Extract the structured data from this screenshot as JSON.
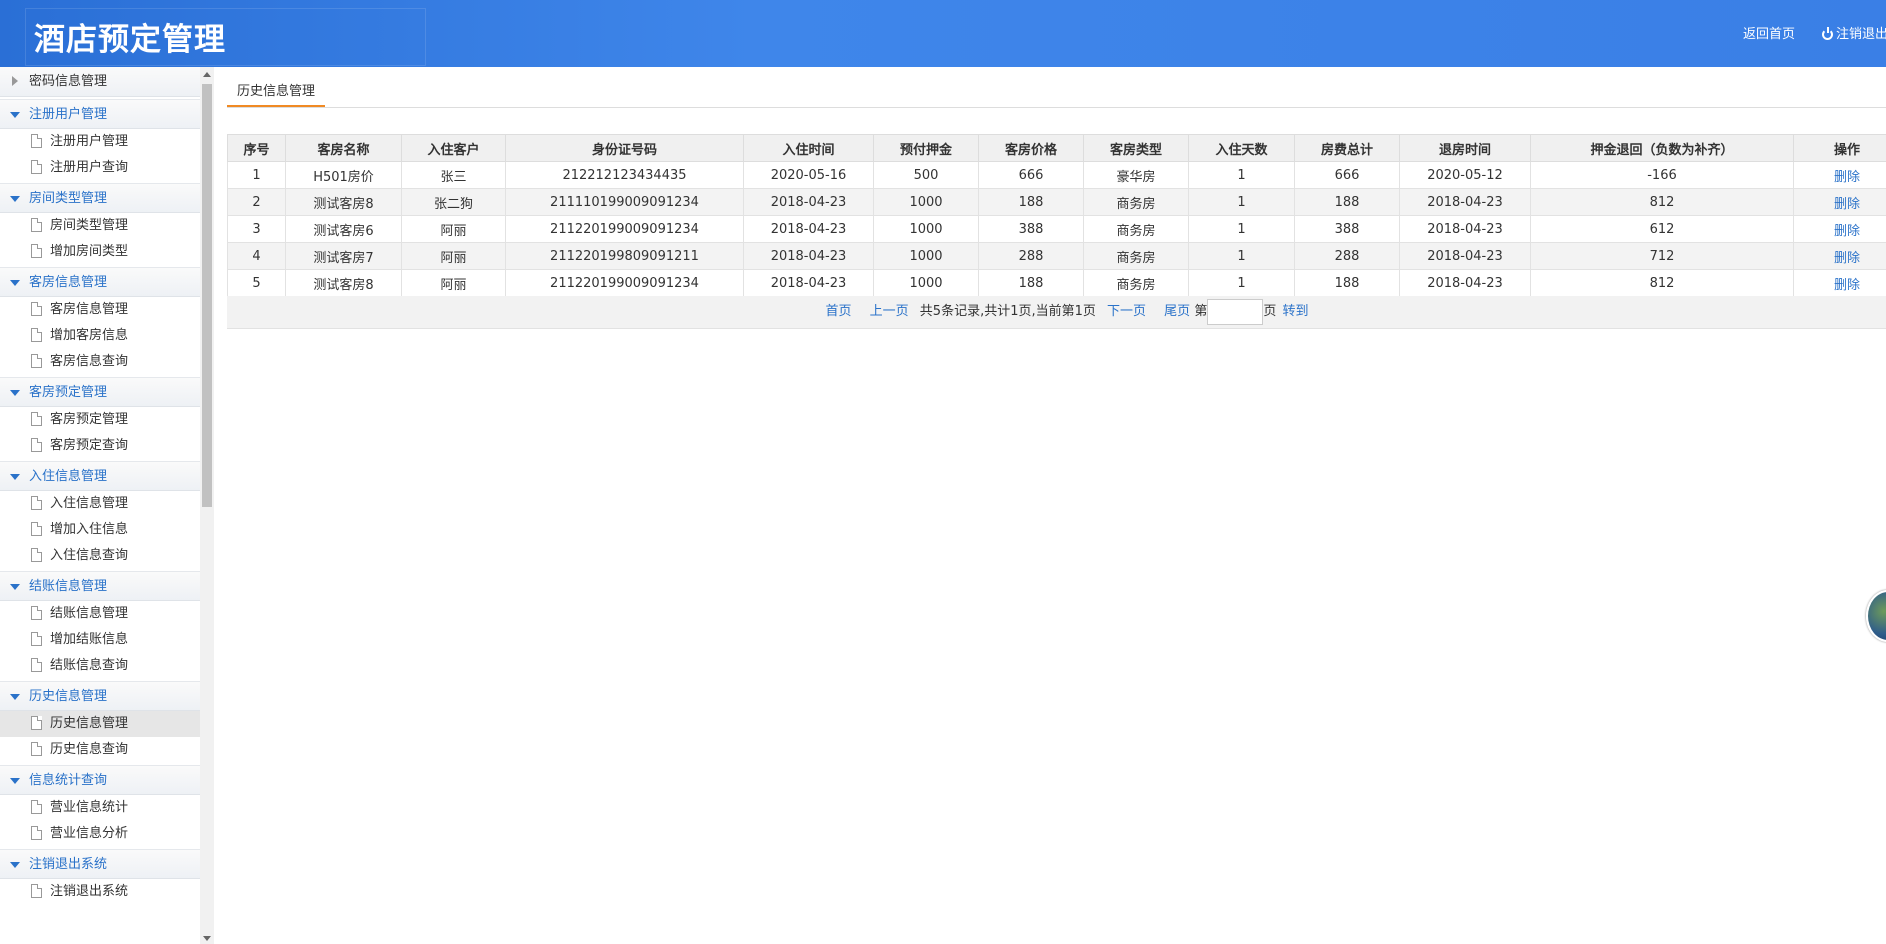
{
  "header": {
    "title": "酒店预定管理",
    "home_link": "返回首页",
    "logout_link": "注销退出"
  },
  "sidebar": {
    "groups": [
      {
        "label": "密码信息管理",
        "items": []
      },
      {
        "label": "注册用户管理",
        "items": [
          "注册用户管理",
          "注册用户查询"
        ]
      },
      {
        "label": "房间类型管理",
        "items": [
          "房间类型管理",
          "增加房间类型"
        ]
      },
      {
        "label": "客房信息管理",
        "items": [
          "客房信息管理",
          "增加客房信息",
          "客房信息查询"
        ]
      },
      {
        "label": "客房预定管理",
        "items": [
          "客房预定管理",
          "客房预定查询"
        ]
      },
      {
        "label": "入住信息管理",
        "items": [
          "入住信息管理",
          "增加入住信息",
          "入住信息查询"
        ]
      },
      {
        "label": "结账信息管理",
        "items": [
          "结账信息管理",
          "增加结账信息",
          "结账信息查询"
        ]
      },
      {
        "label": "历史信息管理",
        "items": [
          "历史信息管理",
          "历史信息查询"
        ]
      },
      {
        "label": "信息统计查询",
        "items": [
          "营业信息统计",
          "营业信息分析"
        ]
      },
      {
        "label": "注销退出系统",
        "items": [
          "注销退出系统"
        ]
      }
    ],
    "active_item": "历史信息管理"
  },
  "main": {
    "tab_label": "历史信息管理",
    "table": {
      "columns": [
        "序号",
        "客房名称",
        "入住客户",
        "身份证号码",
        "入住时间",
        "预付押金",
        "客房价格",
        "客房类型",
        "入住天数",
        "房费总计",
        "退房时间",
        "押金退回（负数为补齐）",
        "操作"
      ],
      "rows": [
        [
          "1",
          "H501房价",
          "张三",
          "212212123434435",
          "2020-05-16",
          "500",
          "666",
          "豪华房",
          "1",
          "666",
          "2020-05-12",
          "-166",
          "删除"
        ],
        [
          "2",
          "测试客房8",
          "张二狗",
          "211110199009091234",
          "2018-04-23",
          "1000",
          "188",
          "商务房",
          "1",
          "188",
          "2018-04-23",
          "812",
          "删除"
        ],
        [
          "3",
          "测试客房6",
          "阿丽",
          "211220199009091234",
          "2018-04-23",
          "1000",
          "388",
          "商务房",
          "1",
          "388",
          "2018-04-23",
          "612",
          "删除"
        ],
        [
          "4",
          "测试客房7",
          "阿丽",
          "211220199809091211",
          "2018-04-23",
          "1000",
          "288",
          "商务房",
          "1",
          "288",
          "2018-04-23",
          "712",
          "删除"
        ],
        [
          "5",
          "测试客房8",
          "阿丽",
          "211220199009091234",
          "2018-04-23",
          "1000",
          "188",
          "商务房",
          "1",
          "188",
          "2018-04-23",
          "812",
          "删除"
        ]
      ]
    },
    "pager": {
      "first": "首页",
      "prev": "上一页",
      "summary": "共5条记录,共计1页,当前第1页",
      "next": "下一页",
      "last": "尾页",
      "page_prefix": "第",
      "page_suffix": "页",
      "jump": "转到"
    }
  }
}
